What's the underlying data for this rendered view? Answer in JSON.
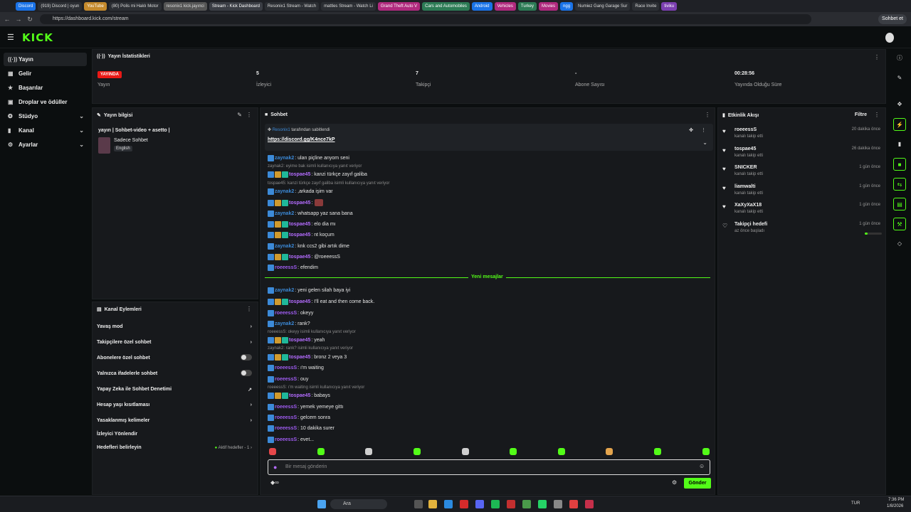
{
  "browser": {
    "tabs": [
      "Discord",
      "(919) Discord | oyun",
      "YouTube",
      "(80) Polis mi Haklı Motor",
      "resonix1 kick.jayınci",
      "Stream - Kick Dashboard",
      "Resonix1 Stream - Watch",
      "mattles Stream - Watch Li",
      "Grand Theft Auto V",
      "Cars and Automobiles",
      "Android",
      "Vehicles",
      "Turkey",
      "Movies",
      "ngg",
      "Numiez Gang Garage Sur",
      "Race Invite",
      "tiviku"
    ],
    "url": "https://dashboard.kick.com/stream",
    "chat_button": "Sohbet et"
  },
  "logo": "KICK",
  "sidebar": {
    "items": [
      {
        "label": "Yayın",
        "icon": "broadcast-icon"
      },
      {
        "label": "Gelir",
        "icon": "money-icon"
      },
      {
        "label": "Başarılar",
        "icon": "trophy-icon"
      },
      {
        "label": "Droplar ve ödüller",
        "icon": "gift-icon"
      },
      {
        "label": "Stüdyo",
        "icon": "palette-icon"
      },
      {
        "label": "Kanal",
        "icon": "channel-icon"
      },
      {
        "label": "Ayarlar",
        "icon": "gear-icon"
      }
    ]
  },
  "stats": {
    "title": "Yayın İstatistikleri",
    "items": [
      {
        "value": "YAYINDA",
        "label": "Yayın"
      },
      {
        "value": "5",
        "label": "İzleyici"
      },
      {
        "value": "7",
        "label": "Takipçi"
      },
      {
        "value": "-",
        "label": "Abone Sayısı"
      },
      {
        "value": "00:28:56",
        "label": "Yayında Olduğu Süre"
      }
    ]
  },
  "stream_info": {
    "title": "Yayın bilgisi",
    "stream_title": "yayın | Sohbet-video + asetto |",
    "category": "Sadece Sohbet",
    "language": "English"
  },
  "channel_actions": {
    "title": "Kanal Eylemleri",
    "items": [
      "Yavaş mod",
      "Takipçilere özel sohbet",
      "Abonelere özel sohbet",
      "Yalnızca ifadelerle sohbet",
      "Yapay Zeka ile Sohbet Denetimi",
      "Hesap yaşı kısıtlaması",
      "Yasaklanmış kelimeler",
      "İzleyici Yönlendir",
      "Hedefleri belirleyin"
    ],
    "goals_status": "Aktif hedefler - 1"
  },
  "chat": {
    "title": "Sohbet",
    "pinned_by": "Resonix1",
    "pinned_suffix": "tarafından sabitlendi",
    "pinned_link": "https://discord.gg/K4nce7kP",
    "new_messages": "Yeni mesajlar",
    "input_placeholder": "Bir mesaj gönderin",
    "send": "Gönder",
    "messages": [
      {
        "user": "zaynak2",
        "text": ": ulan piçline anyom seni"
      },
      {
        "reply": "zaynak2: eyime bak isimli kullanıcıya yanıt veriyor"
      },
      {
        "user": "tospae45",
        "text": ": kanzi türkçe zayıf galiba"
      },
      {
        "reply": "tospae45: kanzi türkçe zayıf galiba isimli kullanıcıya yanıt veriyor"
      },
      {
        "user": "zaynak2",
        "text": ": ,arkada işim var"
      },
      {
        "user": "tospae45",
        "text": ":"
      },
      {
        "user": "zaynak2",
        "text": ": whatsapp yaz sana bana"
      },
      {
        "user": "tospae45",
        "text": ": elo dia mı"
      },
      {
        "user": "tospae45",
        "text": ": nt koçum"
      },
      {
        "user": "zaynak2",
        "text": ": knk ccs2 gibi artık dime"
      },
      {
        "user": "tospae45",
        "text": ": @roeeessS"
      },
      {
        "user": "roeeessS",
        "text": ": efendim"
      },
      {
        "user": "zaynak2",
        "text": ": yeni gelen silah baya iyi"
      },
      {
        "user": "tospae45",
        "text": ": I'll eat and then come back."
      },
      {
        "user": "roeeessS",
        "text": ": okeyy"
      },
      {
        "user": "zaynak2",
        "text": ": rank?"
      },
      {
        "reply": "roeeessS: okeyy isimli kullanıcıya yanıt veriyor"
      },
      {
        "user": "tospae45",
        "text": ": yeah"
      },
      {
        "reply": "zaynak2: rank? isimli kullanıcıya yanıt veriyor"
      },
      {
        "user": "tospae45",
        "text": ": bronz 2 veya 3"
      },
      {
        "user": "roeeessS",
        "text": ": ı'm waiting"
      },
      {
        "user": "roeeessS",
        "text": ": ouy"
      },
      {
        "reply": "roeeessS: ı'm waiting isimli kullanıcıya yanıt veriyor"
      },
      {
        "user": "tospae45",
        "text": ": babays"
      },
      {
        "user": "roeeessS",
        "text": ": yemek yemeye gittı"
      },
      {
        "user": "roeeessS",
        "text": ": gelcem sonra"
      },
      {
        "user": "roeeessS",
        "text": ": 10 dakika surer"
      },
      {
        "user": "roeeessS",
        "text": ": evet..."
      }
    ]
  },
  "activity": {
    "title": "Etkinlik Akışı",
    "filter": "Filtre",
    "events": [
      {
        "name": "roeeessS",
        "sub": "kanalı takip etti",
        "time": "20 dakika önce"
      },
      {
        "name": "tospae45",
        "sub": "kanalı takip etti",
        "time": "26 dakika önce"
      },
      {
        "name": "SNICKER",
        "sub": "kanalı takip etti",
        "time": "1 gün önce"
      },
      {
        "name": "liamwalti",
        "sub": "kanalı takip etti",
        "time": "1 gün önce"
      },
      {
        "name": "XaXyXaX18",
        "sub": "kanalı takip etti",
        "time": "1 gün önce"
      },
      {
        "name": "Takipçi hedefi",
        "sub": "az önce başladı",
        "time": "1 gün önce"
      }
    ]
  },
  "taskbar": {
    "search": "Ara",
    "lang": "TUR",
    "time": "7:36 PM",
    "date": "1/8/2026"
  },
  "colors": {
    "accent": "#53fc18",
    "live": "#e91916",
    "bg": "#0b0e0f",
    "panel": "#17191c"
  }
}
